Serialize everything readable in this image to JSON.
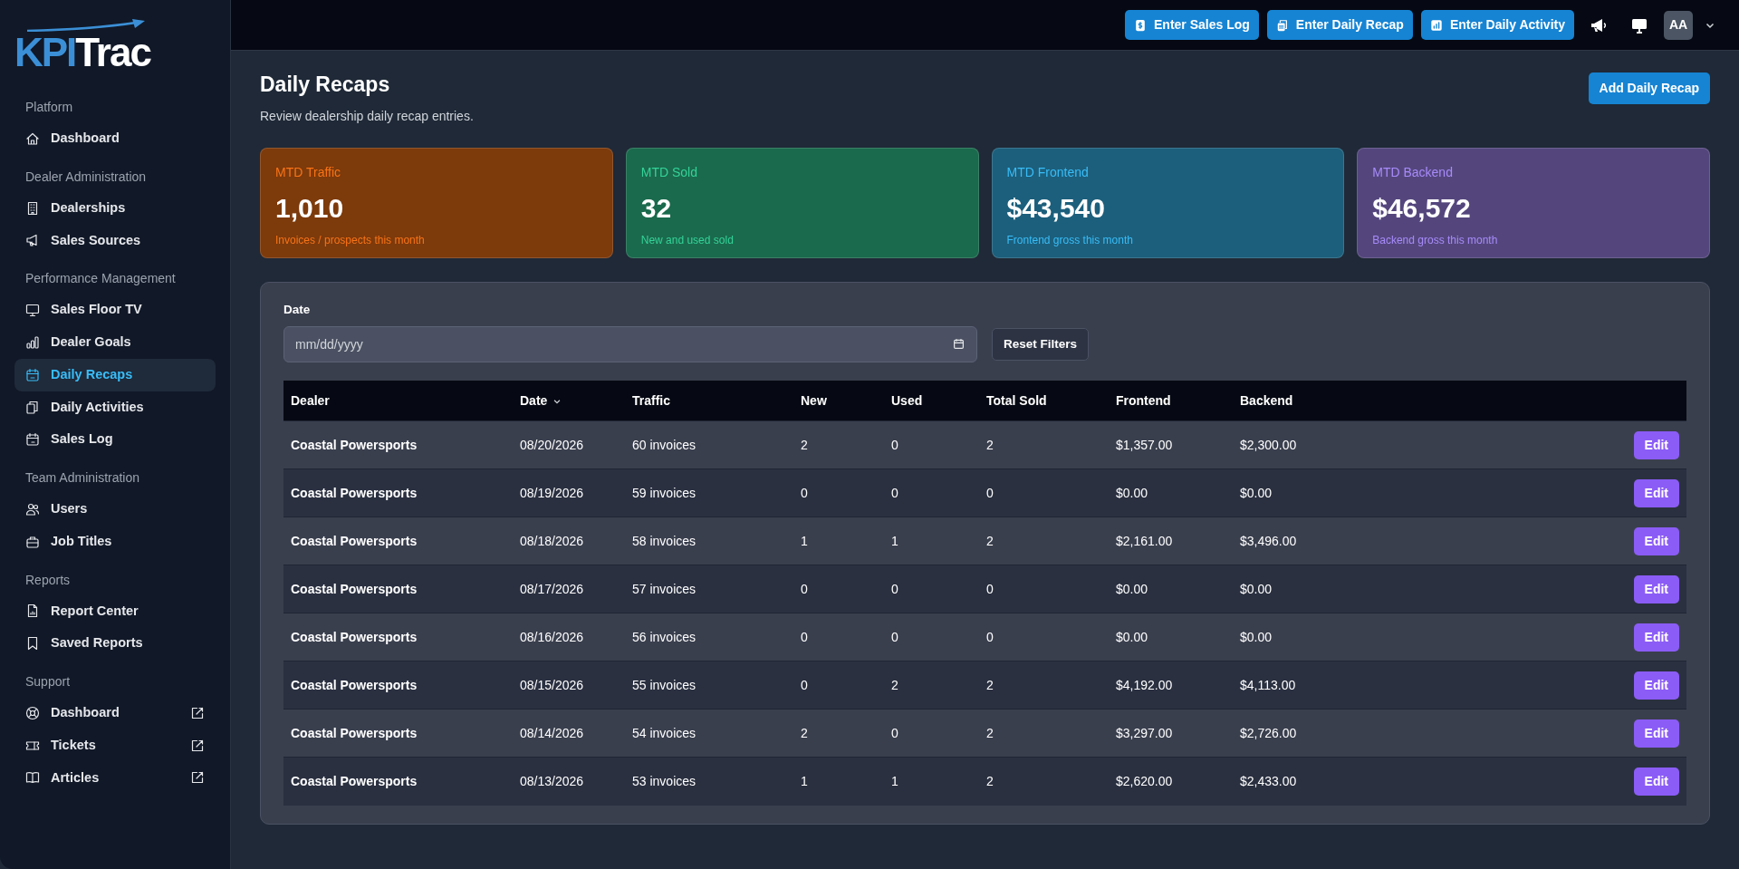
{
  "sidebar": {
    "logo": {
      "part_1": "KPI",
      "part_2": "Trac"
    },
    "sections": [
      {
        "title": "Platform",
        "items": [
          {
            "label": "Dashboard",
            "selected": false,
            "external": false
          }
        ]
      },
      {
        "title": "Dealer Administration",
        "items": [
          {
            "label": "Dealerships",
            "selected": false,
            "external": false
          },
          {
            "label": "Sales Sources",
            "selected": false,
            "external": false
          }
        ]
      },
      {
        "title": "Performance Management",
        "items": [
          {
            "label": "Sales Floor TV",
            "selected": false,
            "external": false
          },
          {
            "label": "Dealer Goals",
            "selected": false,
            "external": false
          },
          {
            "label": "Daily Recaps",
            "selected": true,
            "external": false
          },
          {
            "label": "Daily Activities",
            "selected": false,
            "external": false
          },
          {
            "label": "Sales Log",
            "selected": false,
            "external": false
          }
        ]
      },
      {
        "title": "Team Administration",
        "items": [
          {
            "label": "Users",
            "selected": false,
            "external": false
          },
          {
            "label": "Job Titles",
            "selected": false,
            "external": false
          }
        ]
      },
      {
        "title": "Reports",
        "items": [
          {
            "label": "Report Center",
            "selected": false,
            "external": false
          },
          {
            "label": "Saved Reports",
            "selected": false,
            "external": false
          }
        ]
      },
      {
        "title": "Support",
        "items": [
          {
            "label": "Dashboard",
            "selected": false,
            "external": true
          },
          {
            "label": "Tickets",
            "selected": false,
            "external": true
          },
          {
            "label": "Articles",
            "selected": false,
            "external": true
          }
        ]
      }
    ]
  },
  "topbar": {
    "buttons": [
      "Enter Sales Log",
      "Enter Daily Recap",
      "Enter Daily Activity"
    ],
    "avatar": "AA"
  },
  "page": {
    "title": "Daily Recaps",
    "subtitle": "Review dealership daily recap entries.",
    "add_button": "Add Daily Recap"
  },
  "stats": [
    {
      "label": "MTD Traffic",
      "value": "1,010",
      "note": "Invoices / prospects this month",
      "color": "#f97316"
    },
    {
      "label": "MTD Sold",
      "value": "32",
      "note": "New and used sold",
      "color": "#34d399"
    },
    {
      "label": "MTD Frontend",
      "value": "$43,540",
      "note": "Frontend gross this month",
      "color": "#38bdf8"
    },
    {
      "label": "MTD Backend",
      "value": "$46,572",
      "note": "Backend gross this month",
      "color": "#a78bfa"
    }
  ],
  "filters": {
    "date_label": "Date",
    "date_placeholder": "mm/dd/yyyy",
    "reset_button": "Reset Filters"
  },
  "table": {
    "columns": [
      {
        "label": "Dealer",
        "sorted": false
      },
      {
        "label": "Date",
        "sorted": true
      },
      {
        "label": "Traffic",
        "sorted": false
      },
      {
        "label": "New",
        "sorted": false
      },
      {
        "label": "Used",
        "sorted": false
      },
      {
        "label": "Total Sold",
        "sorted": false
      },
      {
        "label": "Frontend",
        "sorted": false
      },
      {
        "label": "Backend",
        "sorted": false
      }
    ],
    "rows": [
      {
        "cells": [
          "Coastal Powersports",
          "08/20/2026",
          "60 invoices",
          "2",
          "0",
          "2",
          "$1,357.00",
          "$2,300.00"
        ],
        "action": "Edit"
      },
      {
        "cells": [
          "Coastal Powersports",
          "08/19/2026",
          "59 invoices",
          "0",
          "0",
          "0",
          "$0.00",
          "$0.00"
        ],
        "action": "Edit"
      },
      {
        "cells": [
          "Coastal Powersports",
          "08/18/2026",
          "58 invoices",
          "1",
          "1",
          "2",
          "$2,161.00",
          "$3,496.00"
        ],
        "action": "Edit"
      },
      {
        "cells": [
          "Coastal Powersports",
          "08/17/2026",
          "57 invoices",
          "0",
          "0",
          "0",
          "$0.00",
          "$0.00"
        ],
        "action": "Edit"
      },
      {
        "cells": [
          "Coastal Powersports",
          "08/16/2026",
          "56 invoices",
          "0",
          "0",
          "0",
          "$0.00",
          "$0.00"
        ],
        "action": "Edit"
      },
      {
        "cells": [
          "Coastal Powersports",
          "08/15/2026",
          "55 invoices",
          "0",
          "2",
          "2",
          "$4,192.00",
          "$4,113.00"
        ],
        "action": "Edit"
      },
      {
        "cells": [
          "Coastal Powersports",
          "08/14/2026",
          "54 invoices",
          "2",
          "0",
          "2",
          "$3,297.00",
          "$2,726.00"
        ],
        "action": "Edit"
      },
      {
        "cells": [
          "Coastal Powersports",
          "08/13/2026",
          "53 invoices",
          "1",
          "1",
          "2",
          "$2,620.00",
          "$2,433.00"
        ],
        "action": "Edit"
      }
    ]
  }
}
